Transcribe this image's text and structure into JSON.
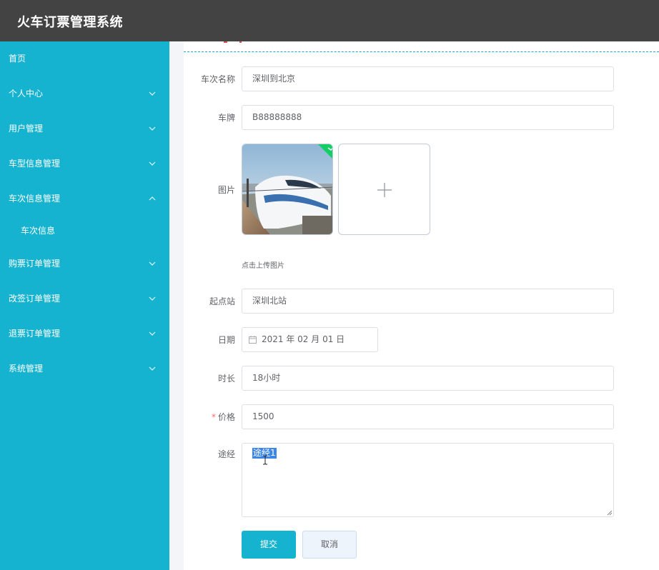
{
  "app": {
    "title": "火车订票管理系统"
  },
  "sidebar": {
    "items": [
      {
        "label": "首页"
      },
      {
        "label": "个人中心"
      },
      {
        "label": "用户管理"
      },
      {
        "label": "车型信息管理"
      },
      {
        "label": "车次信息管理"
      },
      {
        "label": "车次信息"
      },
      {
        "label": "购票订单管理"
      },
      {
        "label": "改签订单管理"
      },
      {
        "label": "退票订单管理"
      },
      {
        "label": "系统管理"
      }
    ]
  },
  "form": {
    "train_name": {
      "label": "车次名称",
      "value": "深圳到北京"
    },
    "plate": {
      "label": "车牌",
      "value": "B88888888"
    },
    "image": {
      "label": "图片",
      "upload_tip": "点击上传图片"
    },
    "start_station": {
      "label": "起点站",
      "value": "深圳北站"
    },
    "date": {
      "label": "日期",
      "value": "2021 年 02 月 01 日"
    },
    "duration": {
      "label": "时长",
      "value": "18小时"
    },
    "price": {
      "required_mark": "*",
      "label": "价格",
      "value": "1500"
    },
    "route": {
      "label": "途经",
      "value": "途经1"
    },
    "submit_label": "提交",
    "cancel_label": "取消"
  },
  "colors": {
    "topbar": "#434343",
    "sidebar": "#16b3d1",
    "accent": "#16b3d1",
    "required": "#f56c6c",
    "success_badge": "#13ce66"
  },
  "icons": {
    "chevron_down": "chevron-down-icon",
    "chevron_up": "chevron-up-icon",
    "calendar": "calendar-icon",
    "plus": "plus-icon",
    "check": "check-icon"
  }
}
